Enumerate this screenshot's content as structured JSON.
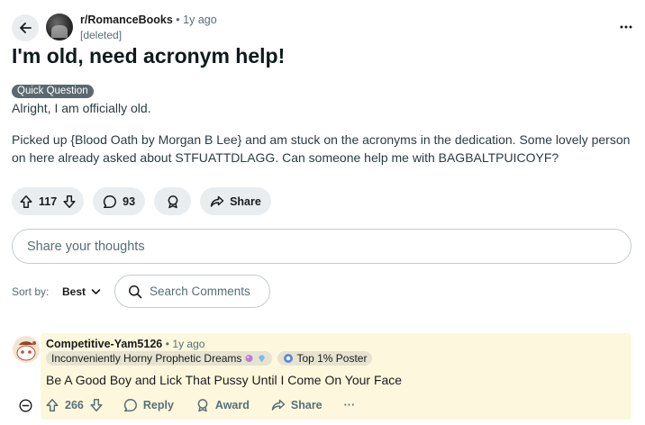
{
  "post": {
    "subreddit": "r/RomanceBooks",
    "separator": "•",
    "age": "1y ago",
    "author": "[deleted]",
    "title": "I'm old, need acronym help!",
    "flair": "Quick Question",
    "body": [
      "Alright, I am officially old.",
      "Picked up {Blood Oath by Morgan B Lee} and am stuck on the acronyms in the dedication. Some lovely person on here already asked about STFUATTDLAGG. Can someone help me with BAGBALTPUICOYF?"
    ],
    "actions": {
      "score": "117",
      "comments": "93",
      "share_label": "Share"
    }
  },
  "composer": {
    "placeholder": "Share your thoughts"
  },
  "sort": {
    "label": "Sort by:",
    "value": "Best",
    "search_placeholder": "Search Comments"
  },
  "comment": {
    "author": "Competitive-Yam5126",
    "separator": "•",
    "age": "1y ago",
    "flair_user": "Inconveniently Horny Prophetic Dreams",
    "flair_badge": "Top 1% Poster",
    "text": "Be A Good Boy and Lick That Pussy Until I Come On Your Face",
    "score": "266",
    "reply_label": "Reply",
    "award_label": "Award",
    "share_label": "Share",
    "more_label": "···"
  },
  "colors": {
    "pill_bg": "#eaedef",
    "flair_bg": "#5b6870",
    "highlight_bg": "#fdf8dd",
    "muted_text": "#576f76"
  },
  "icons": [
    "back-arrow-icon",
    "overflow-icon",
    "upvote-icon",
    "downvote-icon",
    "comment-icon",
    "award-icon",
    "share-icon",
    "search-icon",
    "chevron-down-icon",
    "collapse-icon",
    "more-icon"
  ]
}
